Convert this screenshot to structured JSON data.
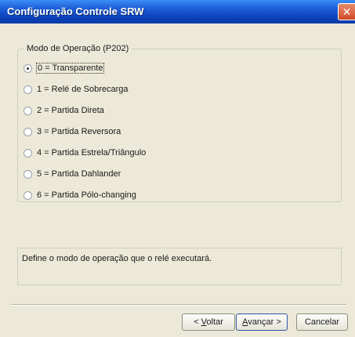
{
  "window": {
    "title": "Configuração Controle SRW",
    "close_glyph": "✕"
  },
  "group": {
    "legend": "Modo de Operação (P202)",
    "options": [
      {
        "label": "0 = Transparente",
        "checked": true
      },
      {
        "label": "1 = Relé de Sobrecarga",
        "checked": false
      },
      {
        "label": "2 = Partida Direta",
        "checked": false
      },
      {
        "label": "3 = Partida Reversora",
        "checked": false
      },
      {
        "label": "4 = Partida Estrela/Triângulo",
        "checked": false
      },
      {
        "label": "5 = Partida Dahlander",
        "checked": false
      },
      {
        "label": "6 = Partida Pólo-changing",
        "checked": false
      }
    ]
  },
  "description": "Define o modo de operação que o relé executará.",
  "buttons": {
    "back_prefix": "< ",
    "back_mnemonic": "V",
    "back_rest": "oltar",
    "next_mnemonic": "A",
    "next_rest": "vançar >",
    "cancel": "Cancelar"
  },
  "colors": {
    "title_bar": "#0a3fb8",
    "dialog_bg": "#ece9d8",
    "close_button": "#cf4a26"
  }
}
